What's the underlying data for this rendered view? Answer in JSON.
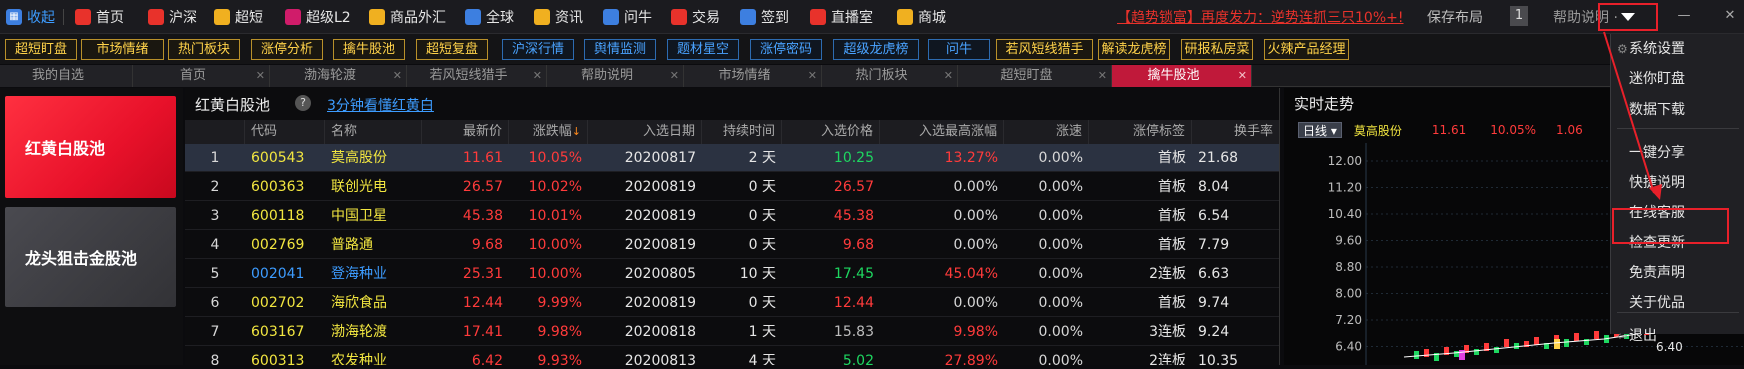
{
  "topbar": {
    "collapse": "收起",
    "items": [
      {
        "label": "首页",
        "icon": "home-icon",
        "color": "#e8322b"
      },
      {
        "label": "沪深",
        "icon": "hushen-icon",
        "color": "#e8322b"
      },
      {
        "label": "超短",
        "icon": "chaoduan-icon",
        "color": "#f0b020"
      },
      {
        "label": "超级L2",
        "icon": "l2-icon",
        "color": "#d01c6a"
      },
      {
        "label": "商品外汇",
        "icon": "coin-icon",
        "color": "#f0b020"
      },
      {
        "label": "全球",
        "icon": "globe-icon",
        "color": "#3d7fe0"
      },
      {
        "label": "资讯",
        "icon": "news-icon",
        "color": "#f0b020"
      },
      {
        "label": "问牛",
        "icon": "search-icon",
        "color": "#3d7fe0"
      },
      {
        "label": "交易",
        "icon": "trade-icon",
        "color": "#e8322b"
      },
      {
        "label": "签到",
        "icon": "calendar-icon",
        "color": "#3d7fe0"
      },
      {
        "label": "直播室",
        "icon": "play-icon",
        "color": "#e8322b"
      },
      {
        "label": "商城",
        "icon": "shop-icon",
        "color": "#f0b020"
      }
    ],
    "promo": "【趋势锁富】再度发力：逆势连抓三只10%+!",
    "save_layout": "保存布局",
    "layout_num": "1",
    "help": "帮助说明 ·"
  },
  "quick_buttons": [
    {
      "label": "超短盯盘",
      "style": "y"
    },
    {
      "label": "市场情绪",
      "style": "y"
    },
    {
      "label": "热门板块",
      "style": "y"
    },
    {
      "label": "涨停分析",
      "style": "y"
    },
    {
      "label": "擒牛股池",
      "style": "y"
    },
    {
      "label": "超短复盘",
      "style": "y"
    },
    {
      "label": "沪深行情",
      "style": "b"
    },
    {
      "label": "舆情监测",
      "style": "b"
    },
    {
      "label": "题材星空",
      "style": "b"
    },
    {
      "label": "涨停密码",
      "style": "b"
    },
    {
      "label": "超级龙虎榜",
      "style": "b"
    },
    {
      "label": "问牛",
      "style": "b"
    },
    {
      "label": "若风短线猎手",
      "style": "y"
    },
    {
      "label": "解读龙虎榜",
      "style": "y"
    },
    {
      "label": "研报私房菜",
      "style": "y"
    },
    {
      "label": "火辣产品经理",
      "style": "y"
    }
  ],
  "tabs": [
    {
      "label": "我的自选",
      "active": false
    },
    {
      "label": "首页",
      "active": false
    },
    {
      "label": "渤海轮渡",
      "active": false
    },
    {
      "label": "若风短线猎手",
      "active": false
    },
    {
      "label": "帮助说明",
      "active": false
    },
    {
      "label": "市场情绪",
      "active": false
    },
    {
      "label": "热门板块",
      "active": false
    },
    {
      "label": "超短盯盘",
      "active": false
    },
    {
      "label": "擒牛股池",
      "active": true
    }
  ],
  "left_cards": {
    "card1": "红黄白股池",
    "card2": "龙头狙击金股池"
  },
  "pool": {
    "title": "红黄白股池",
    "help_icon": "?",
    "link": "3分钟看懂红黄白"
  },
  "table": {
    "headers": [
      "代码",
      "名称",
      "最新价",
      "涨跌幅",
      "入选日期",
      "持续时间",
      "入选价格",
      "入选最高涨幅",
      "涨速",
      "涨停标签",
      "换手率"
    ],
    "sort_mark": "↓",
    "rows": [
      {
        "no": "1",
        "code": "600543",
        "name": "莫高股份",
        "price": "11.61",
        "chg": "10.05%",
        "date": "20200817",
        "dur": "2 天",
        "inprice": "10.25",
        "maxchg": "13.27%",
        "speed": "0.00%",
        "tag": "首板",
        "turnover": "21.68"
      },
      {
        "no": "2",
        "code": "600363",
        "name": "联创光电",
        "price": "26.57",
        "chg": "10.02%",
        "date": "20200819",
        "dur": "0 天",
        "inprice": "26.57",
        "maxchg": "0.00%",
        "speed": "0.00%",
        "tag": "首板",
        "turnover": "8.04"
      },
      {
        "no": "3",
        "code": "600118",
        "name": "中国卫星",
        "price": "45.38",
        "chg": "10.01%",
        "date": "20200819",
        "dur": "0 天",
        "inprice": "45.38",
        "maxchg": "0.00%",
        "speed": "0.00%",
        "tag": "首板",
        "turnover": "6.54"
      },
      {
        "no": "4",
        "code": "002769",
        "name": "普路通",
        "price": "9.68",
        "chg": "10.00%",
        "date": "20200819",
        "dur": "0 天",
        "inprice": "9.68",
        "maxchg": "0.00%",
        "speed": "0.00%",
        "tag": "首板",
        "turnover": "7.79"
      },
      {
        "no": "5",
        "code": "002041",
        "name": "登海种业",
        "price": "25.31",
        "chg": "10.00%",
        "date": "20200805",
        "dur": "10 天",
        "inprice": "17.45",
        "maxchg": "45.04%",
        "speed": "0.00%",
        "tag": "2连板",
        "turnover": "6.63"
      },
      {
        "no": "6",
        "code": "002702",
        "name": "海欣食品",
        "price": "12.44",
        "chg": "9.99%",
        "date": "20200819",
        "dur": "0 天",
        "inprice": "12.44",
        "maxchg": "0.00%",
        "speed": "0.00%",
        "tag": "首板",
        "turnover": "9.74"
      },
      {
        "no": "7",
        "code": "603167",
        "name": "渤海轮渡",
        "price": "17.41",
        "chg": "9.98%",
        "date": "20200818",
        "dur": "1 天",
        "inprice": "15.83",
        "maxchg": "9.98%",
        "speed": "0.00%",
        "tag": "3连板",
        "turnover": "9.24"
      },
      {
        "no": "8",
        "code": "600313",
        "name": "农发种业",
        "price": "6.42",
        "chg": "9.93%",
        "date": "20200813",
        "dur": "4 天",
        "inprice": "5.02",
        "maxchg": "27.89%",
        "speed": "0.00%",
        "tag": "2连板",
        "turnover": "10.35"
      }
    ]
  },
  "realtime": {
    "title": "实时走势",
    "period": "日线",
    "stock": "莫高股份",
    "price": "11.61",
    "chg": "10.05%",
    "diff": "1.06",
    "y_labels": [
      "12.00",
      "11.20",
      "10.40",
      "9.60",
      "8.80",
      "8.00",
      "7.20",
      "6.40"
    ],
    "right_label": "6.40"
  },
  "menu": {
    "items": [
      {
        "label": "系统设置",
        "icon": "gear-icon"
      },
      {
        "label": "迷你盯盘",
        "icon": ""
      },
      {
        "label": "数据下载",
        "icon": ""
      },
      {
        "label": "一键分享",
        "icon": ""
      },
      {
        "label": "快捷说明",
        "icon": ""
      },
      {
        "label": "在线客服",
        "icon": ""
      },
      {
        "label": "检查更新",
        "icon": ""
      },
      {
        "label": "免责声明",
        "icon": ""
      },
      {
        "label": "关于优品",
        "icon": ""
      },
      {
        "label": "退出",
        "icon": "exit-icon"
      }
    ]
  },
  "colors": {
    "up": "#ff3b3b",
    "down": "#1ed760",
    "flat": "#d8d8d8",
    "code_yellow": "#f2e640",
    "code_blue": "#3d9cff",
    "accent_red": "#c0193a"
  }
}
